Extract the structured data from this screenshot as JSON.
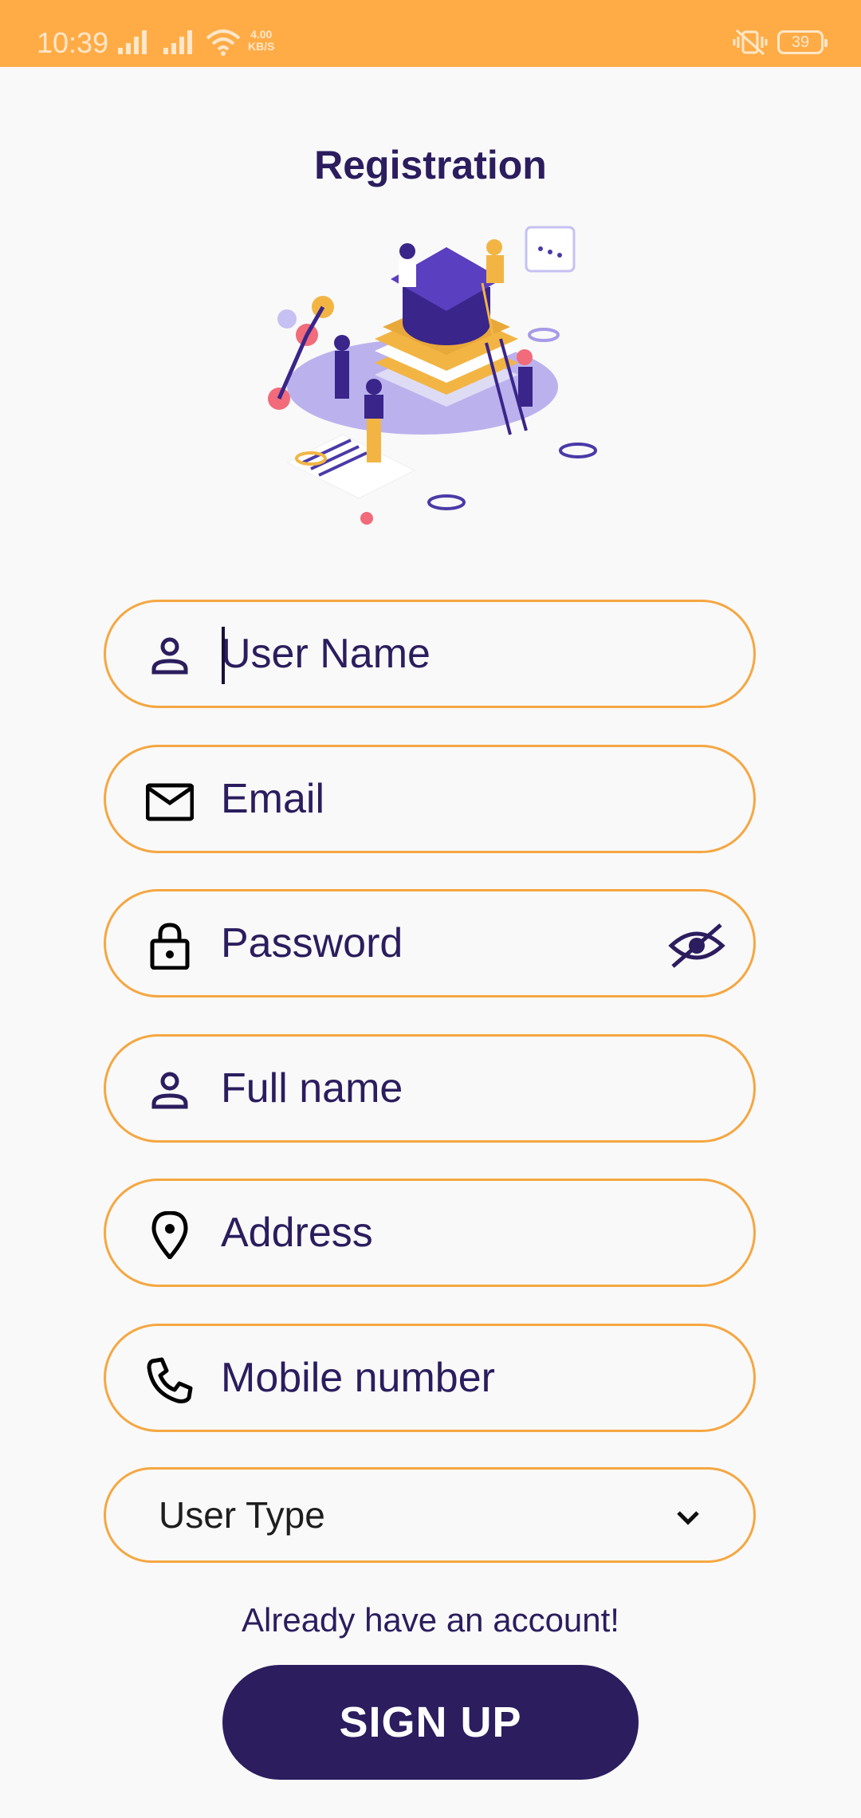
{
  "status_bar": {
    "time": "10:39",
    "net_speed_value": "4.00",
    "net_speed_unit": "KB/S",
    "battery": "39"
  },
  "page": {
    "title": "Registration"
  },
  "form": {
    "username_placeholder": "User Name",
    "email_placeholder": "Email",
    "password_placeholder": "Password",
    "fullname_placeholder": "Full name",
    "address_placeholder": "Address",
    "mobile_placeholder": "Mobile number",
    "user_type_label": "User Type"
  },
  "footer": {
    "already_text": "Already have an account!",
    "signup_label": "SIGN UP"
  },
  "colors": {
    "accent": "#ffac47",
    "field_border": "#f5a742",
    "primary": "#2b1d5e"
  },
  "icons": [
    "person-icon",
    "mail-icon",
    "lock-icon",
    "eye-off-icon",
    "location-pin-icon",
    "phone-icon",
    "chevron-down-icon"
  ]
}
